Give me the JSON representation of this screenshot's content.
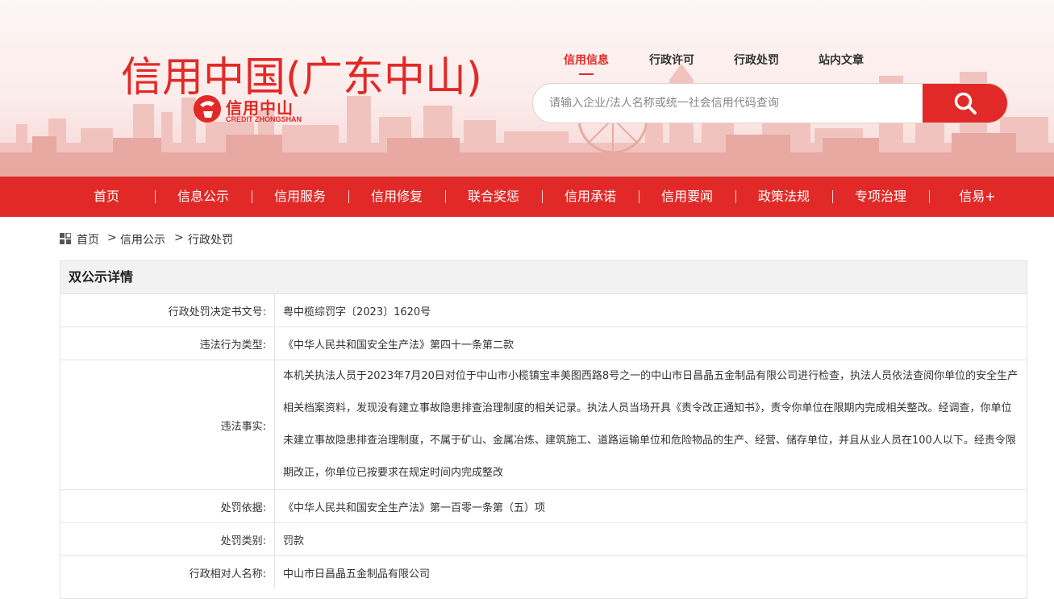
{
  "site": {
    "title": "信用中国(广东中山)",
    "logo_cn": "信用中山",
    "logo_en": "CREDIT ZHONGSHAN"
  },
  "top_links": [
    {
      "label": "信用信息",
      "active": true
    },
    {
      "label": "行政许可",
      "active": false
    },
    {
      "label": "行政处罚",
      "active": false
    },
    {
      "label": "站内文章",
      "active": false
    }
  ],
  "search": {
    "placeholder": "请输入企业/法人名称或统一社会信用代码查询",
    "icon": "search-icon"
  },
  "nav": [
    {
      "label": "首页"
    },
    {
      "label": "信息公示"
    },
    {
      "label": "信用服务"
    },
    {
      "label": "信用修复"
    },
    {
      "label": "联合奖惩"
    },
    {
      "label": "信用承诺"
    },
    {
      "label": "信用要闻"
    },
    {
      "label": "政策法规"
    },
    {
      "label": "专项治理"
    },
    {
      "label": "信易+"
    }
  ],
  "breadcrumb": {
    "icon": "grid-icon",
    "items": [
      "首页",
      "信用公示",
      "行政处罚"
    ],
    "separator": ">"
  },
  "detail": {
    "title": "双公示详情",
    "rows": [
      {
        "label": "行政处罚决定书文号:",
        "value": "粤中榄综罚字〔2023〕1620号"
      },
      {
        "label": "违法行为类型:",
        "value": "《中华人民共和国安全生产法》第四十一条第二款"
      },
      {
        "label": "违法事实:",
        "lines": [
          "本机关执法人员于2023年7月20日对位于中山市小榄镇宝丰美图西路8号之一的中山市日昌晶五金制品有限公司进行检查，执法人员依法查阅你单位的安全生产",
          "相关档案资料，发现没有建立事故隐患排查治理制度的相关记录。执法人员当场开具《责令改正通知书》，责令你单位在限期内完成相关整改。经调查，你单位",
          "未建立事故隐患排查治理制度，不属于矿山、金属冶炼、建筑施工、道路运输单位和危险物品的生产、经营、储存单位，并且从业人员在100人以下。经责令限",
          "期改正，你单位已按要求在规定时间内完成整改"
        ]
      },
      {
        "label": "处罚依据:",
        "value": "《中华人民共和国安全生产法》第一百零一条第（五）项"
      },
      {
        "label": "处罚类别:",
        "value": "罚款"
      },
      {
        "label": "行政相对人名称:",
        "value": "中山市日昌晶五金制品有限公司"
      }
    ]
  },
  "colors": {
    "brand_red": "#e12a27",
    "panel_header_bg": "#f2f2f2",
    "border": "#e3e3e3"
  }
}
